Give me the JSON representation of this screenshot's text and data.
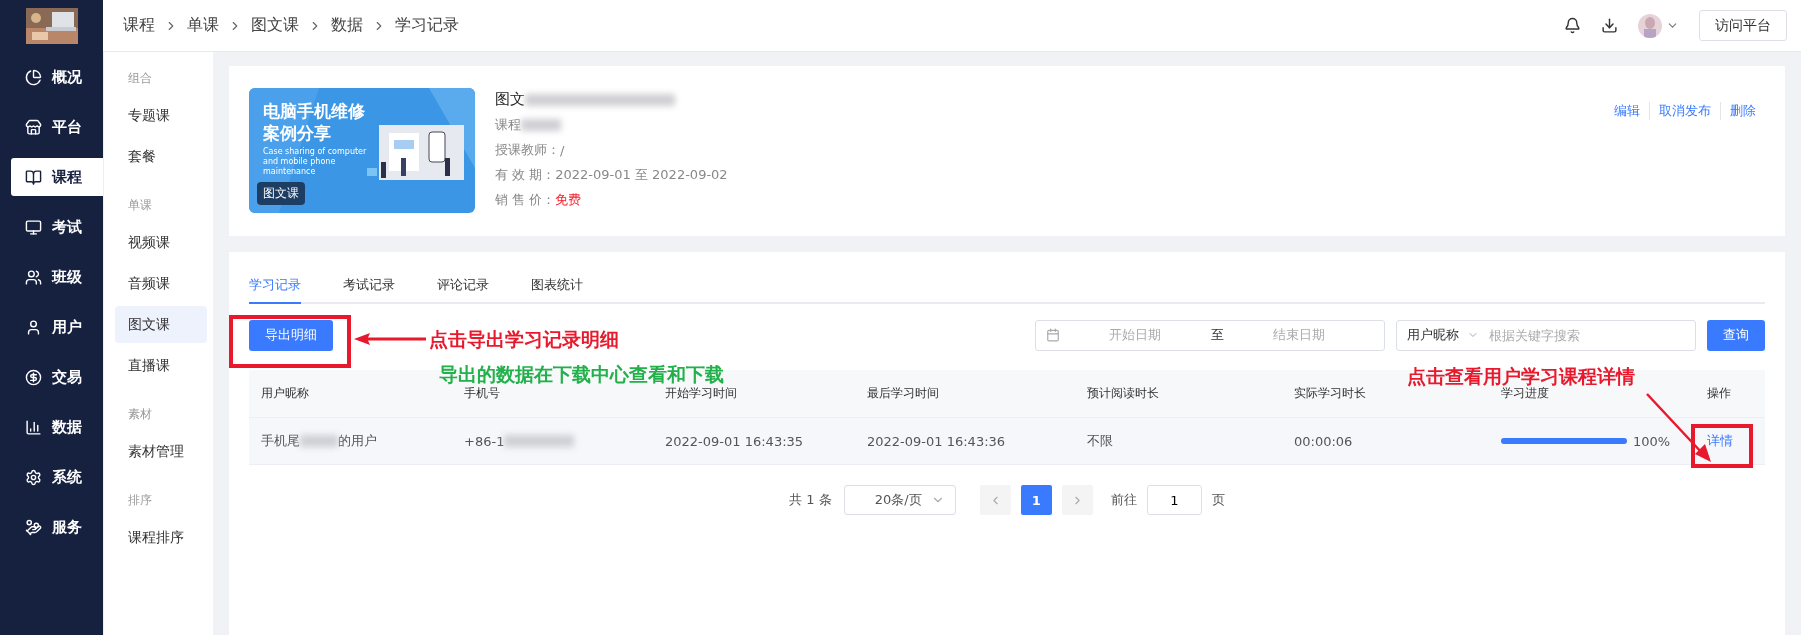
{
  "sidebar": {
    "items": [
      {
        "label": "概况",
        "selected": false
      },
      {
        "label": "平台",
        "selected": false
      },
      {
        "label": "课程",
        "selected": true
      },
      {
        "label": "考试",
        "selected": false
      },
      {
        "label": "班级",
        "selected": false
      },
      {
        "label": "用户",
        "selected": false
      },
      {
        "label": "交易",
        "selected": false
      },
      {
        "label": "数据",
        "selected": false
      },
      {
        "label": "系统",
        "selected": false
      },
      {
        "label": "服务",
        "selected": false
      }
    ]
  },
  "subnav": {
    "groups": [
      {
        "title": "组合",
        "items": [
          {
            "label": "专题课",
            "selected": false
          },
          {
            "label": "套餐",
            "selected": false
          }
        ]
      },
      {
        "title": "单课",
        "items": [
          {
            "label": "视频课",
            "selected": false
          },
          {
            "label": "音频课",
            "selected": false
          },
          {
            "label": "图文课",
            "selected": true
          },
          {
            "label": "直播课",
            "selected": false
          }
        ]
      },
      {
        "title": "素材",
        "items": [
          {
            "label": "素材管理",
            "selected": false
          }
        ]
      },
      {
        "title": "排序",
        "items": [
          {
            "label": "课程排序",
            "selected": false
          }
        ]
      }
    ]
  },
  "breadcrumb": [
    "课程",
    "单课",
    "图文课",
    "数据",
    "学习记录"
  ],
  "topbar": {
    "button": "访问平台"
  },
  "course": {
    "cover": {
      "title_lines": [
        "电脑手机维修",
        "案例分享"
      ],
      "subtitle": "Case sharing of computer and mobile phone maintenance",
      "badge": "图文课"
    },
    "title": "图文",
    "category": "课程",
    "fields": [
      {
        "label": "授课教师：",
        "value": "/",
        "kind": "plain"
      },
      {
        "label": "有 效 期：",
        "value": "2022-09-01 至 2022-09-02",
        "kind": "plain"
      },
      {
        "label": "销 售 价：",
        "value": "免费",
        "kind": "price"
      }
    ],
    "actions": [
      "编辑",
      "取消发布",
      "删除"
    ]
  },
  "tabs": [
    {
      "label": "学习记录",
      "selected": true
    },
    {
      "label": "考试记录",
      "selected": false
    },
    {
      "label": "评论记录",
      "selected": false
    },
    {
      "label": "图表统计",
      "selected": false
    }
  ],
  "toolbar": {
    "export": "导出明细",
    "start_placeholder": "开始日期",
    "range_sep": "至",
    "end_placeholder": "结束日期",
    "search_type": "用户昵称",
    "search_placeholder": "根据关键字搜索",
    "query": "查询"
  },
  "table": {
    "columns": [
      "用户昵称",
      "手机号",
      "开始学习时间",
      "最后学习时间",
      "预计阅读时长",
      "实际学习时长",
      "学习进度",
      "操作"
    ],
    "rows": [
      {
        "name_prefix": "手机尾",
        "name_suffix": "的用户",
        "phone": "+86-1",
        "start": "2022-09-01 16:43:35",
        "last": "2022-09-01 16:43:36",
        "expected": "不限",
        "actual": "00:00:06",
        "level": 1,
        "progress": "100%",
        "action": "详情"
      }
    ]
  },
  "pagination": {
    "total": "共 1 条",
    "page_size": "20条/页",
    "pages": [
      {
        "label": "1",
        "selected": true
      }
    ],
    "goto": "前往",
    "goto_value": "1",
    "page_unit": "页"
  },
  "annotations": {
    "export_note": "点击导出学习记录明细",
    "download_note": "导出的数据在下载中心查看和下载",
    "detail_note": "点击查看用户学习课程详情"
  }
}
